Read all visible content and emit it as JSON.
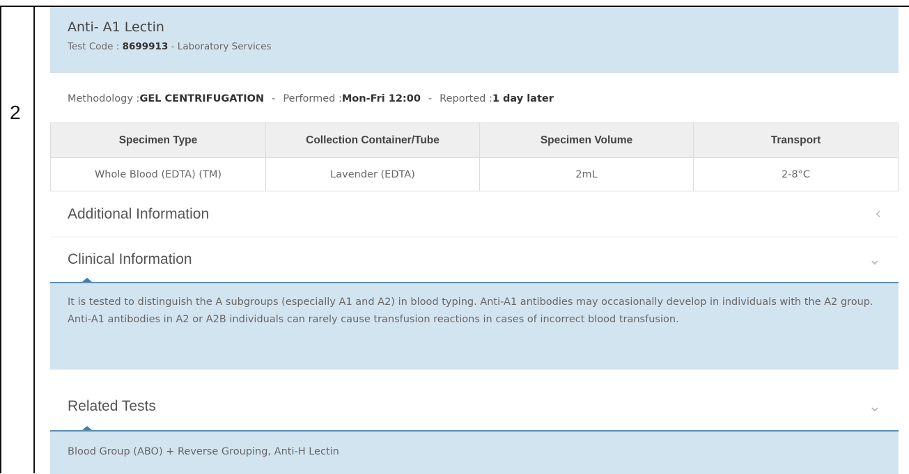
{
  "row_number": "2",
  "test": {
    "title": "Anti- A1 Lectin",
    "code_label": "Test Code : ",
    "code_value": "8699913",
    "code_suffix": " - Laboratory Services"
  },
  "meta": {
    "methodology_label": "Methodology : ",
    "methodology_value": "GEL CENTRIFUGATION",
    "performed_label": "Performed : ",
    "performed_value": "Mon-Fri 12:00",
    "reported_label": "Reported : ",
    "reported_value": "1 day later",
    "separator": "-"
  },
  "specimen_table": {
    "headers": [
      "Specimen Type",
      "Collection Container/Tube",
      "Specimen Volume",
      "Transport"
    ],
    "rows": [
      [
        "Whole Blood (EDTA) (TM)",
        "Lavender (EDTA)",
        "2mL",
        "2-8°C"
      ]
    ]
  },
  "sections": {
    "additional": {
      "label": "Additional Information",
      "icon": "chevron-left-icon"
    },
    "clinical": {
      "label": "Clinical Information",
      "icon": "chevron-down-icon",
      "text": "It is tested to distinguish the A subgroups (especially A1 and A2) in blood typing. Anti-A1 antibodies may occasionally develop in individuals with the A2 group. Anti-A1 antibodies in A2 or A2B individuals can rarely cause transfusion reactions in cases of incorrect blood transfusion."
    },
    "related": {
      "label": "Related Tests",
      "icon": "chevron-down-icon",
      "text": "Blood Group (ABO) + Reverse Grouping, Anti-H Lectin"
    }
  },
  "colors": {
    "header_bg": "#d3e4f1",
    "accent": "#3f7fb0"
  }
}
